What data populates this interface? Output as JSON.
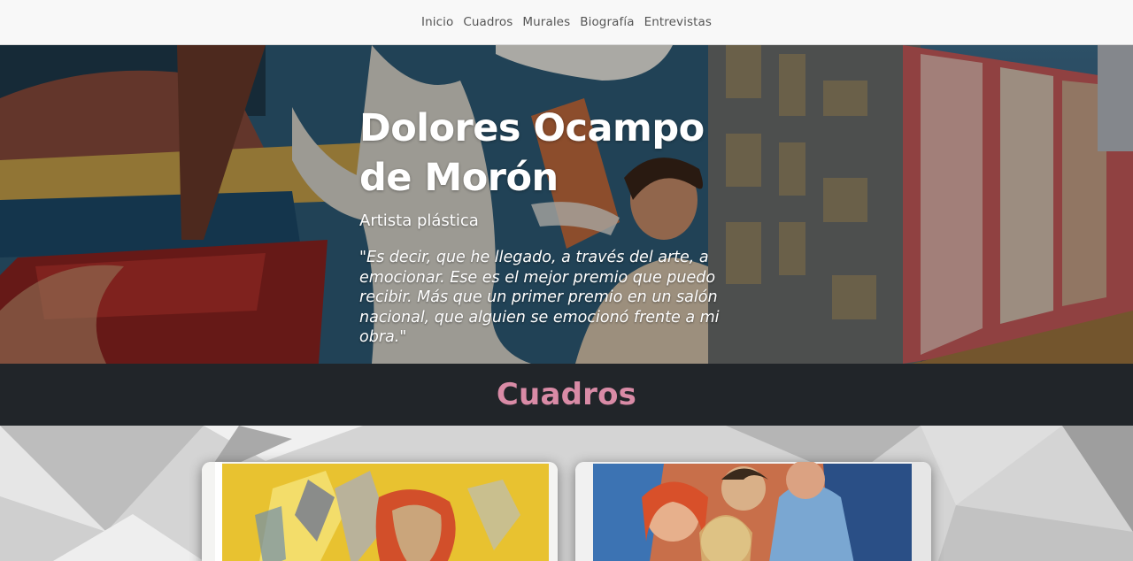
{
  "nav": {
    "items": [
      "Inicio",
      "Cuadros",
      "Murales",
      "Biografía",
      "Entrevistas"
    ]
  },
  "hero": {
    "title_line1": "Dolores Ocampo",
    "title_line2": "de Morón",
    "subtitle": "Artista plástica",
    "quote": "\"Es decir, que he llegado, a través del arte, a emocionar. Ese es el mejor premio que puedo recibir. Más que un primer premio en un salón nacional, que alguien se emocionó frente a mi obra.\""
  },
  "section": {
    "title": "Cuadros"
  },
  "colors": {
    "accent": "#d98ba6",
    "section_bg": "#212529",
    "nav_bg": "#f8f8f8"
  }
}
